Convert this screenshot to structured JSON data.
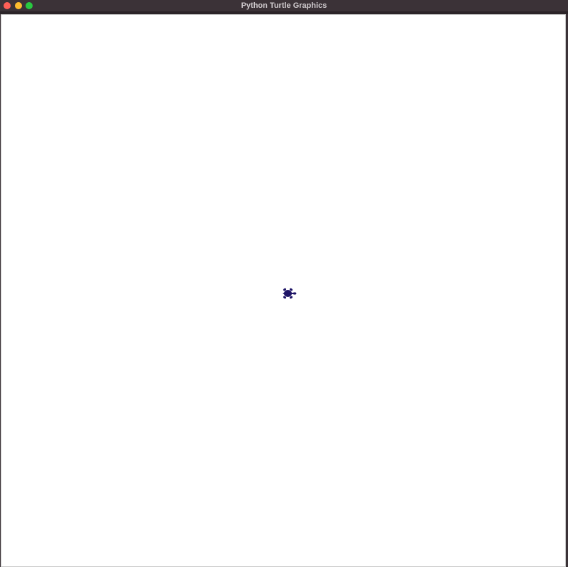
{
  "window": {
    "title": "Python Turtle Graphics"
  },
  "controls": {
    "close_color": "#ff5f57",
    "minimize_color": "#febc2e",
    "zoom_color": "#28c840"
  },
  "canvas": {
    "background": "#ffffff"
  },
  "turtle": {
    "icon": "turtle-icon",
    "color": "#1e1466",
    "heading": "east"
  }
}
